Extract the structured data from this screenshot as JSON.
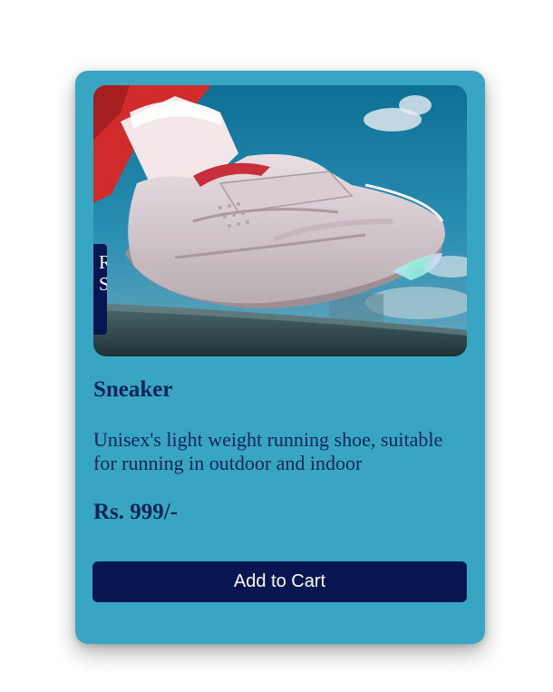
{
  "product": {
    "image_alt": "White sneaker on a railing",
    "badge_text": "R\nS",
    "title": "Sneaker",
    "description": "Unisex's light weight running shoe, suitable for running in outdoor and indoor",
    "price": "Rs. 999/-",
    "cart_button_label": "Add to Cart"
  },
  "colors": {
    "card_background": "#38a6c3",
    "button_background": "#071651",
    "text": "#0d2458"
  }
}
